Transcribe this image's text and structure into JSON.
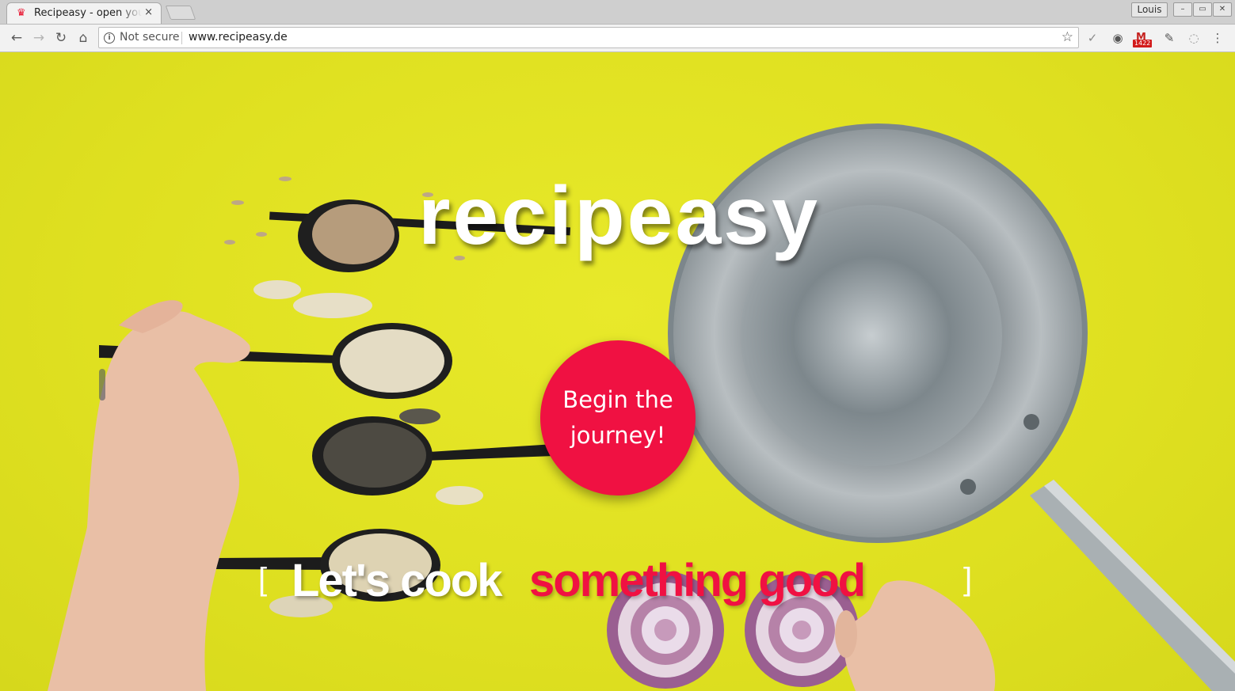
{
  "browser": {
    "tab_title": "Recipeasy - open your",
    "tab_close": "×",
    "profile_name": "Louis",
    "window_buttons": [
      "–",
      "▭",
      "✕"
    ],
    "security_label": "Not secure",
    "url": "www.recipeasy.de",
    "mail_count": "1422"
  },
  "page": {
    "logo": "recipeasy",
    "cta_label": "Begin the journey!",
    "tagline_white": "Let's cook",
    "tagline_red": "something good",
    "bracket_open": "[",
    "bracket_close": "]"
  },
  "colors": {
    "background_yellow": "#dfe022",
    "accent_red": "#f01142",
    "white": "#ffffff"
  }
}
